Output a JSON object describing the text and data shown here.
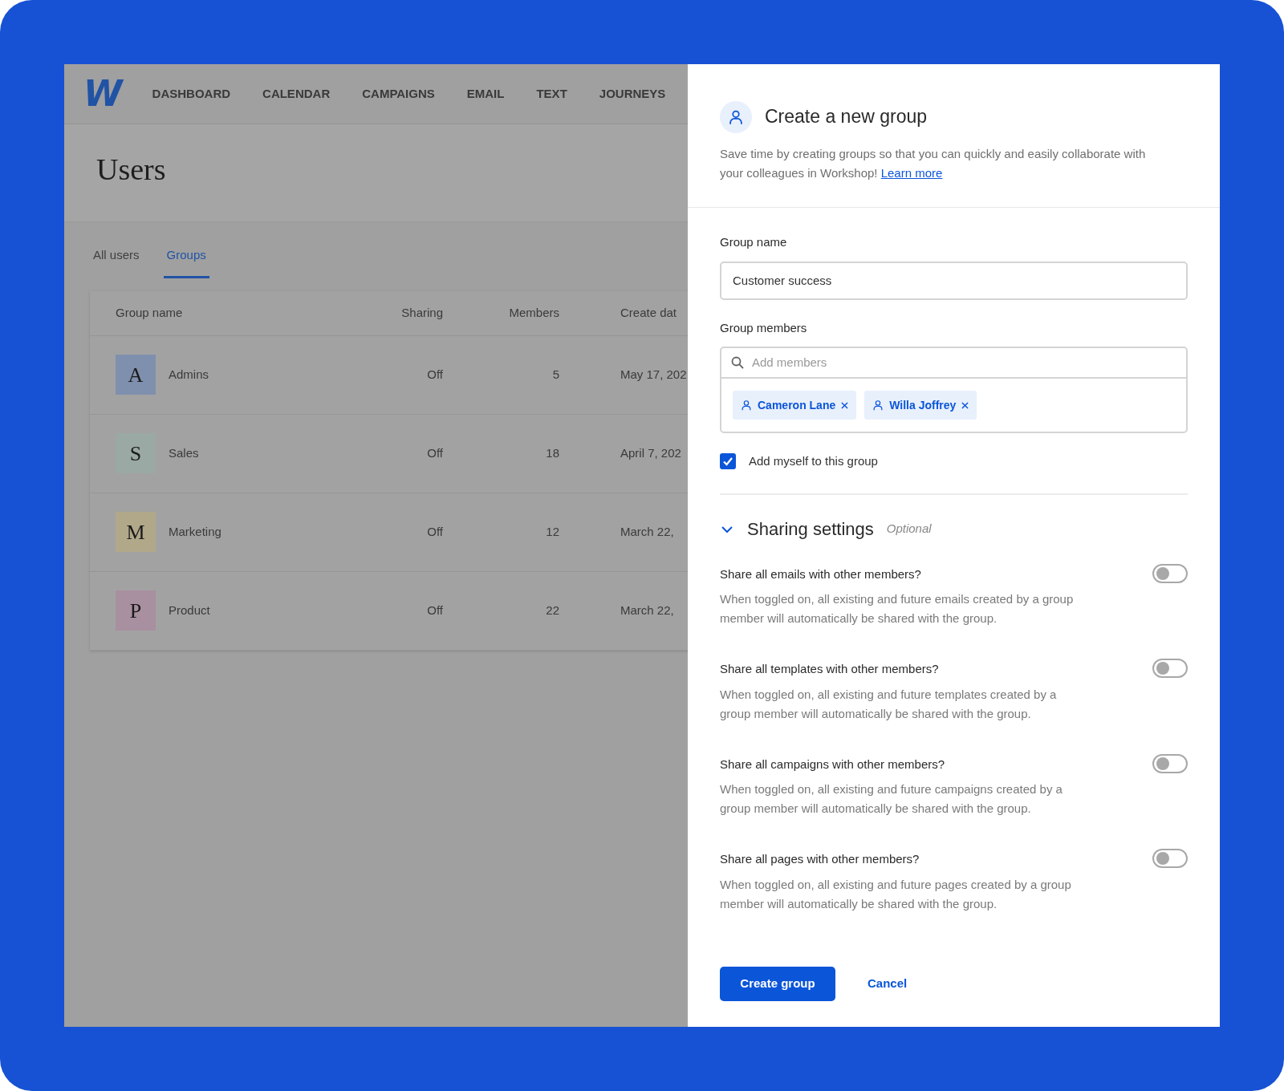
{
  "nav": {
    "logo": "W",
    "items": [
      {
        "label": "DASHBOARD"
      },
      {
        "label": "CALENDAR"
      },
      {
        "label": "CAMPAIGNS"
      },
      {
        "label": "EMAIL"
      },
      {
        "label": "TEXT"
      },
      {
        "label": "JOURNEYS"
      }
    ]
  },
  "page": {
    "title": "Users"
  },
  "tabs": [
    {
      "label": "All users",
      "selected": false
    },
    {
      "label": "Groups",
      "selected": true
    }
  ],
  "table": {
    "columns": [
      "Group name",
      "Sharing",
      "Members",
      "Create dat"
    ],
    "rows": [
      {
        "initial": "A",
        "color": "#7e90ad",
        "name": "Admins",
        "sharing": "Off",
        "members": "5",
        "created": "May 17, 202"
      },
      {
        "initial": "S",
        "color": "#9aa9a4",
        "name": "Sales",
        "sharing": "Off",
        "members": "18",
        "created": "April 7, 202"
      },
      {
        "initial": "M",
        "color": "#b1a88a",
        "name": "Marketing",
        "sharing": "Off",
        "members": "12",
        "created": "March 22,"
      },
      {
        "initial": "P",
        "color": "#a890a0",
        "name": "Product",
        "sharing": "Off",
        "members": "22",
        "created": "March 22,"
      }
    ]
  },
  "panel": {
    "title": "Create a new group",
    "description": "Save time by creating groups so that you can quickly and easily collaborate with your colleagues in Workshop!",
    "link": "Learn more",
    "group_name": {
      "label": "Group name",
      "value": "Customer success"
    },
    "group_members": {
      "label": "Group members",
      "placeholder": "Add members",
      "chips": [
        {
          "name": "Cameron Lane"
        },
        {
          "name": "Willa Joffrey"
        }
      ]
    },
    "add_myself": {
      "label": "Add myself to this group",
      "checked": true
    },
    "sharing": {
      "title": "Sharing settings",
      "optional": "Optional",
      "expanded": true,
      "options": [
        {
          "question": "Share all emails with other members?",
          "description": "When toggled on, all existing and future emails created by a group member will automatically be shared with the group.",
          "on": false
        },
        {
          "question": "Share all templates with other members?",
          "description": "When toggled on, all existing and future templates created by a group member will automatically be shared with the group.",
          "on": false
        },
        {
          "question": "Share all campaigns with other members?",
          "description": "When toggled on, all existing and future campaigns created by a group member will automatically be shared with the group.",
          "on": false
        },
        {
          "question": "Share all pages with other members?",
          "description": "When toggled on, all existing and future pages created by a group member will automatically be shared with the group.",
          "on": false
        }
      ]
    },
    "buttons": {
      "primary": "Create group",
      "secondary": "Cancel"
    }
  }
}
